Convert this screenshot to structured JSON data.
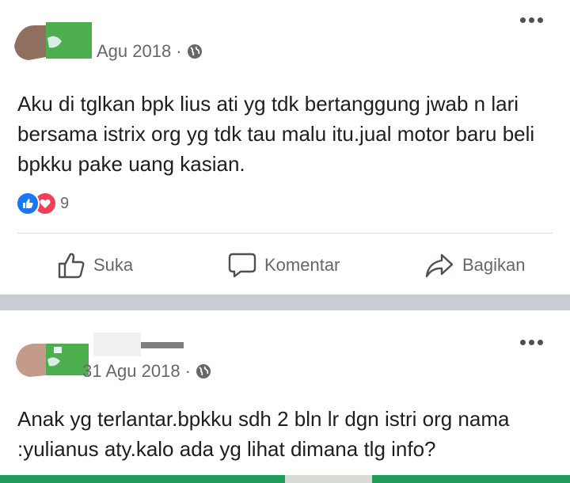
{
  "posts": [
    {
      "date": "Agu 2018",
      "separator": "·",
      "text": "Aku di tglkan bpk lius ati yg tdk bertanggung jwab n lari bersama istrix org yg tdk tau malu itu.jual motor baru beli bpkku pake uang kasian.",
      "reactions": {
        "count": "9",
        "types": [
          "like",
          "love"
        ]
      },
      "actions": {
        "like": "Suka",
        "comment": "Komentar",
        "share": "Bagikan"
      }
    },
    {
      "date": "31 Agu 2018",
      "separator": "·",
      "text": "Anak yg terlantar.bpkku sdh 2 bln lr dgn istri org nama :yulianus aty.kalo ada yg lihat dimana tlg info?"
    }
  ],
  "icons": {
    "privacy": "globe-icon",
    "menu": "more-dots-icon",
    "like": "thumbs-up-icon",
    "comment": "speech-bubble-icon",
    "share": "share-arrow-icon"
  },
  "colors": {
    "like": "#1877f2",
    "love": "#f33e58",
    "secondary_text": "#65676b",
    "separator": "#c9ccd1"
  }
}
